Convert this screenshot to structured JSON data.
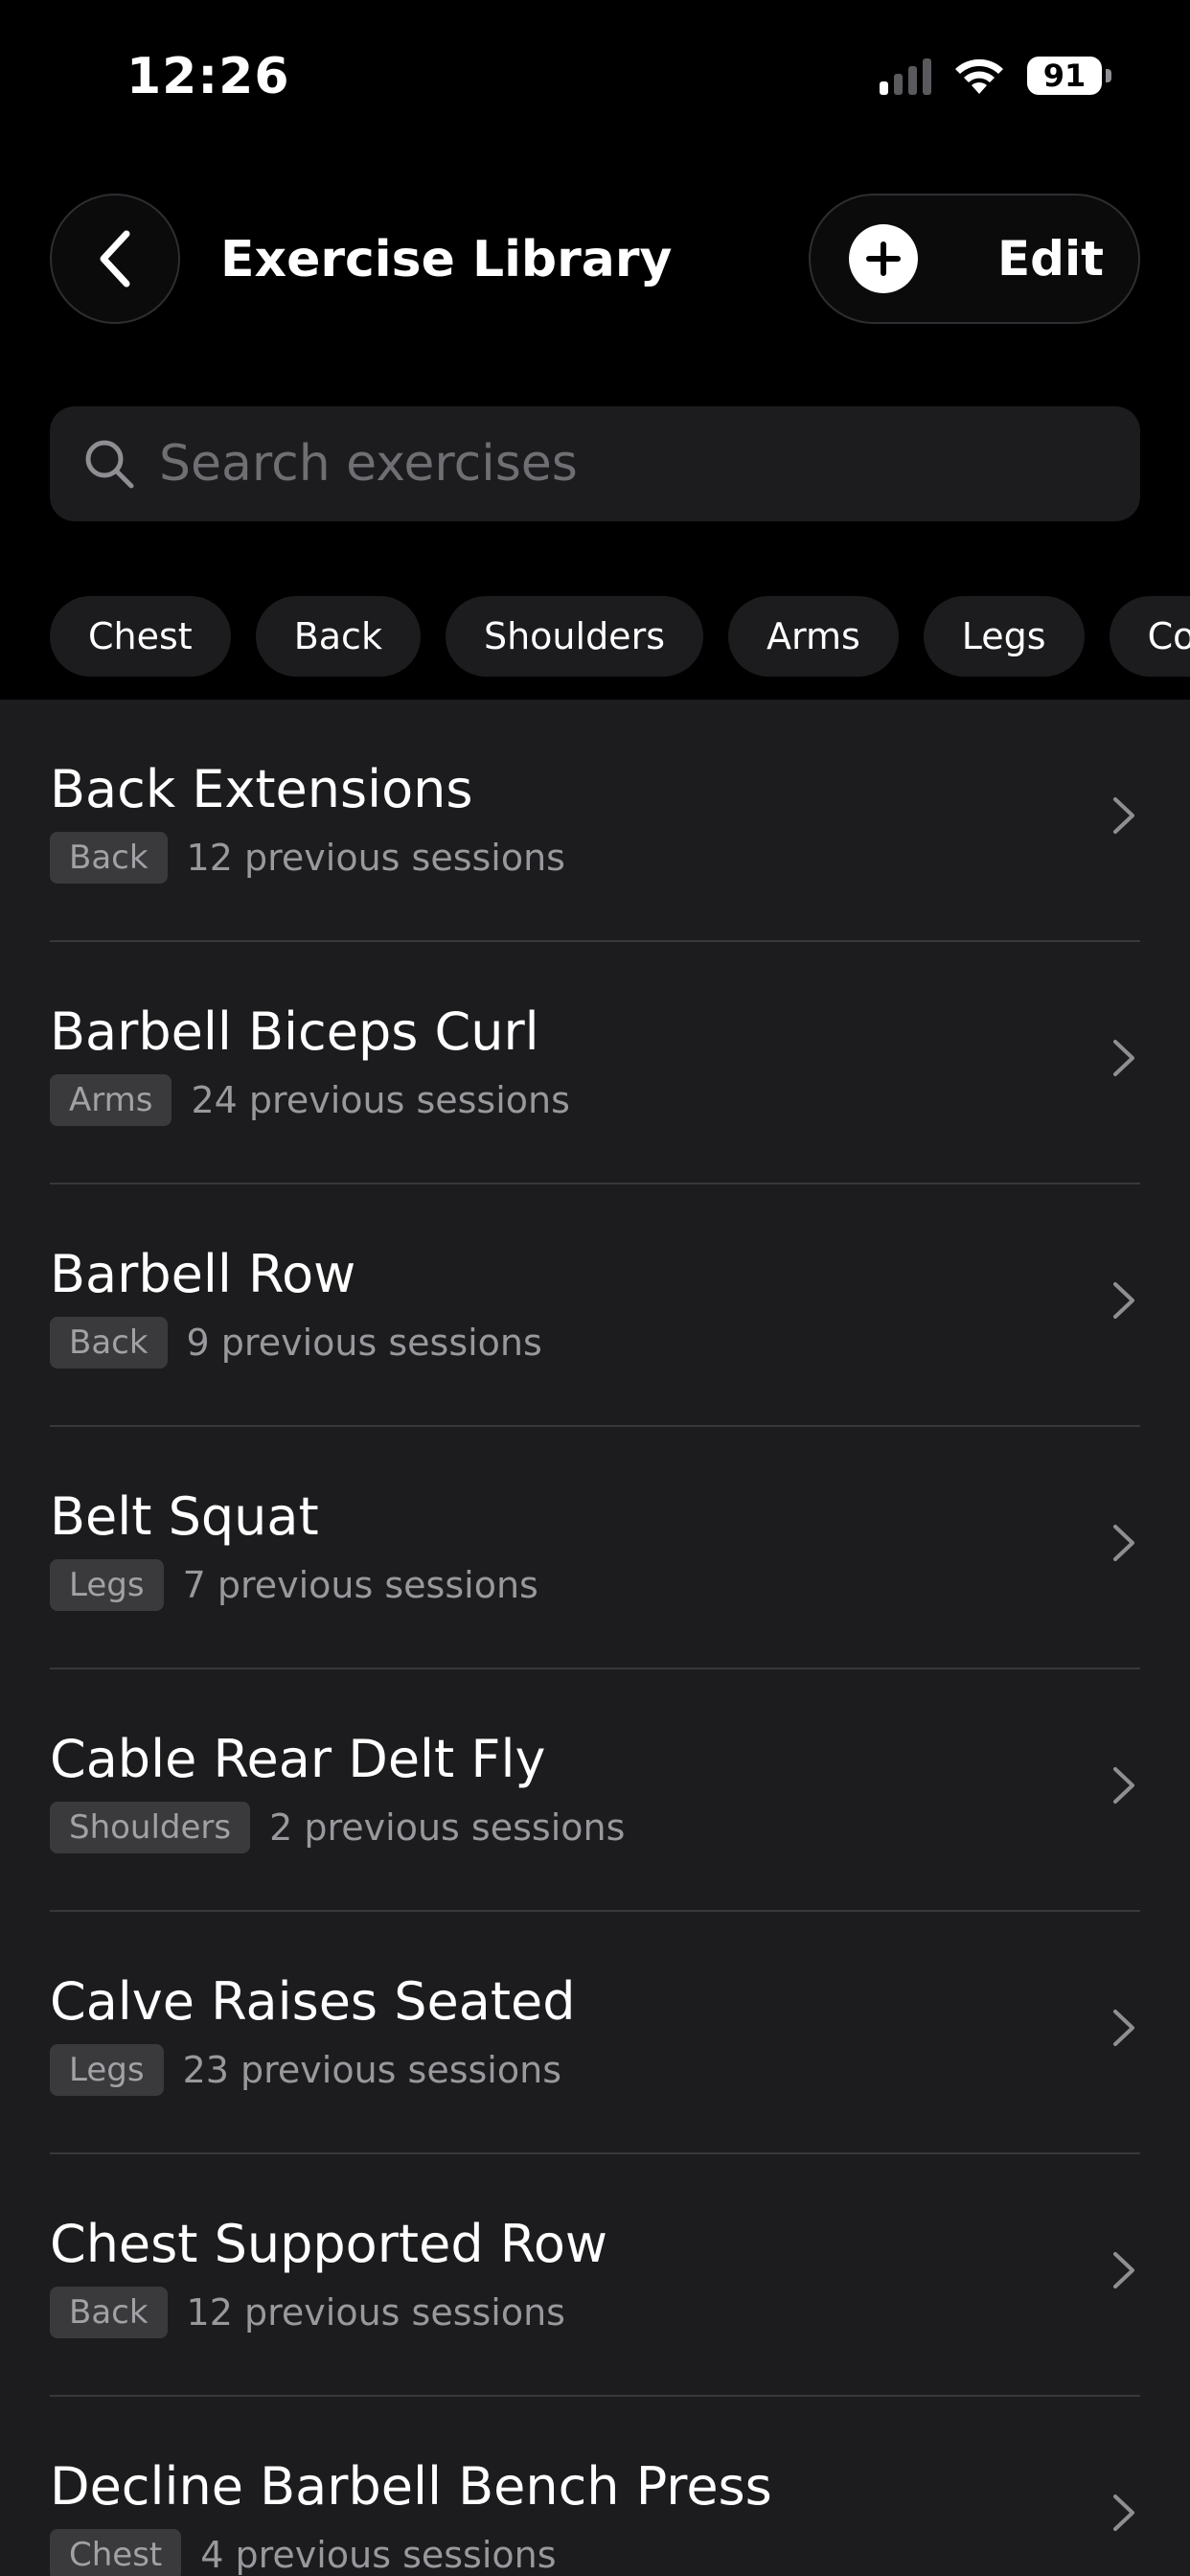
{
  "status_bar": {
    "time": "12:26",
    "battery": "91"
  },
  "header": {
    "title": "Exercise Library",
    "edit_label": "Edit"
  },
  "search": {
    "placeholder": "Search exercises"
  },
  "filters": [
    "Chest",
    "Back",
    "Shoulders",
    "Arms",
    "Legs",
    "Core"
  ],
  "exercises": [
    {
      "name": "Back Extensions",
      "category": "Back",
      "sessions": "12 previous sessions"
    },
    {
      "name": "Barbell Biceps Curl",
      "category": "Arms",
      "sessions": "24 previous sessions"
    },
    {
      "name": "Barbell Row",
      "category": "Back",
      "sessions": "9 previous sessions"
    },
    {
      "name": "Belt Squat",
      "category": "Legs",
      "sessions": "7 previous sessions"
    },
    {
      "name": "Cable Rear Delt Fly",
      "category": "Shoulders",
      "sessions": "2 previous sessions"
    },
    {
      "name": "Calve Raises Seated",
      "category": "Legs",
      "sessions": "23 previous sessions"
    },
    {
      "name": "Chest Supported Row",
      "category": "Back",
      "sessions": "12 previous sessions"
    },
    {
      "name": "Decline Barbell Bench Press",
      "category": "Chest",
      "sessions": "4 previous sessions"
    }
  ],
  "icons": {
    "back": "chevron-left-icon",
    "add": "plus-icon",
    "search": "magnifier-icon",
    "row": "chevron-right-icon"
  },
  "colors": {
    "background": "#000000",
    "surface": "#1c1c1e",
    "tag": "#3a3a3c",
    "secondary_text": "#98989d"
  }
}
